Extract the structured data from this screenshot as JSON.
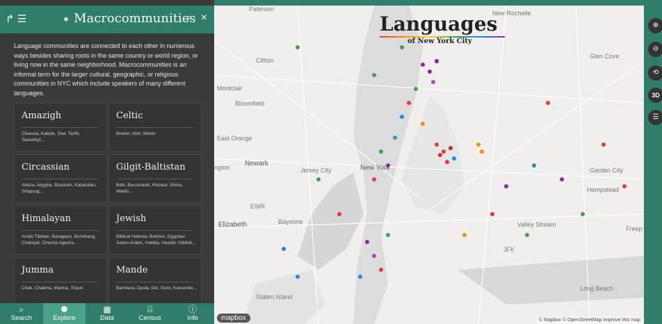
{
  "sidebar": {
    "header": {
      "title": "Macrocommunities",
      "title_glyph": "⁕",
      "left_icons": "↱ ☰",
      "search_icon": "⌕",
      "close_icon": "×"
    },
    "intro": "Language communities are connected to each other in numerous ways besides sharing roots in the same country or world region, or living now in the same neighborhood. Macrocommunities is an informal term for the larger cultural, geographic, or religious communities in NYC which include speakers of many different languages.",
    "cards": [
      {
        "name": "Amazigh",
        "languages": "Chaouia, Kabyle, Siwi, Tarifit, Tashelhyt..."
      },
      {
        "name": "Celtic",
        "languages": "Breton, Irish, Welsh"
      },
      {
        "name": "Circassian",
        "languages": "Abaza, Adyghe, Bzedukh, Kabardian, Shapsug..."
      },
      {
        "name": "Gilgit-Baltistan",
        "languages": "Balti, Burushaski, Khowar, Shina, Wakhi..."
      },
      {
        "name": "Himalayan",
        "languages": "Amdo Tibetan, Baragaun, Bumthang, Chantyal, Chocha-ngacha..."
      },
      {
        "name": "Jewish",
        "languages": "Biblical Hebrew, Bukhori, Egyptian Judeo-Arabic, Hakitia, Hasidic Yiddish..."
      },
      {
        "name": "Jumma",
        "languages": "Chak, Chakma, Marma, Tripuri"
      },
      {
        "name": "Mande",
        "languages": "Bambara, Dyula, Gio, Guro, Kassonke..."
      }
    ],
    "nav": [
      {
        "label": "Search",
        "icon": "⌕"
      },
      {
        "label": "Explore",
        "icon": "⚉"
      },
      {
        "label": "Data",
        "icon": "▦"
      },
      {
        "label": "Census",
        "icon": "⌸"
      },
      {
        "label": "Info",
        "icon": "ⓘ"
      }
    ]
  },
  "map": {
    "brand_title": "Languages",
    "brand_subtitle": "of New York City",
    "labels": {
      "paterson": "Paterson",
      "new_rochelle": "New Rochelle",
      "clifton": "Clifton",
      "glen_cove": "Glen Cove",
      "montclair": "Montclair",
      "bloomfield": "Bloomfield",
      "east_orange": "East Orange",
      "irvington": "ngton",
      "newark": "Newark",
      "jersey_city": "Jersey City",
      "new_york": "New York",
      "garden_city": "Garden City",
      "hempstead": "Hempstead",
      "ewr": "EWR",
      "elizabeth": "Elizabeth",
      "bayonne": "Bayonne",
      "valley_stream": "Valley Stream",
      "freeport": "Freep",
      "jfk": "JFK",
      "staten_island": "Staten Island",
      "long_beach": "Long Beach"
    },
    "mapbox_logo": "mapbox",
    "attribution": "© Mapbox © OpenStreetMap Improve this map",
    "controls": [
      "⊕",
      "⊖",
      "⟲",
      "3D",
      "☰"
    ]
  }
}
